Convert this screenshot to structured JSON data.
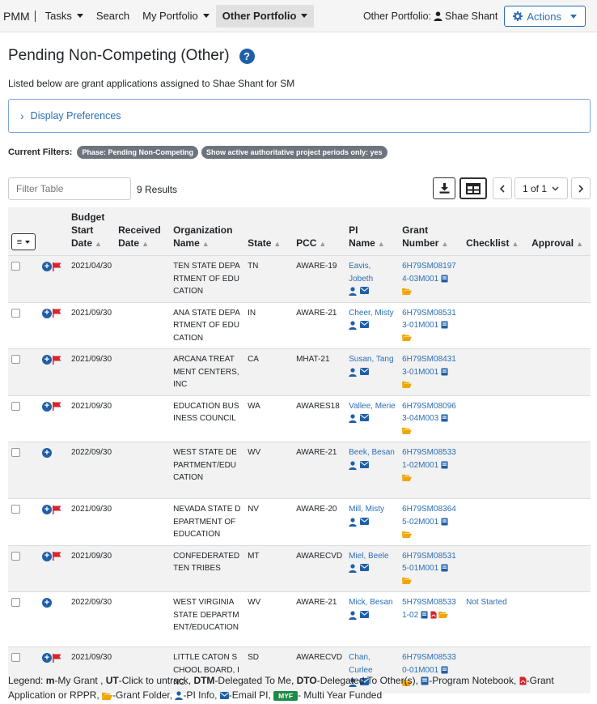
{
  "nav": {
    "brand": "PMM",
    "items": [
      {
        "label": "Tasks",
        "dropdown": true
      },
      {
        "label": "Search",
        "dropdown": false
      },
      {
        "label": "My Portfolio",
        "dropdown": true
      },
      {
        "label": "Other Portfolio",
        "dropdown": true,
        "active": true
      }
    ],
    "other_portfolio_label": "Other Portfolio:",
    "other_portfolio_user": "Shae Shant",
    "actions_label": "Actions"
  },
  "page": {
    "title": "Pending Non-Competing (Other)",
    "subtitle": "Listed below are grant applications assigned to Shae Shant for SM",
    "display_preferences": "Display Preferences",
    "current_filters_label": "Current Filters:",
    "filters": [
      "Phase: Pending Non-Competing",
      "Show active authoritative project periods only: yes"
    ]
  },
  "toolbar": {
    "filter_placeholder": "Filter Table",
    "results": "9 Results",
    "page": "1 of 1"
  },
  "table": {
    "headers": [
      "Budget Start Date",
      "Received Date",
      "Organization Name",
      "State",
      "PCC",
      "PI Name",
      "Grant Number",
      "Checklist",
      "Approval"
    ],
    "rows": [
      {
        "flag": true,
        "budget_start": "2021/04/30",
        "received": "",
        "org": "TEN STATE DEPARTMENT OF EDUCATION",
        "state": "TN",
        "pcc": "AWARE-19",
        "pi": "Eavis, Jobeth",
        "grant": "6H79SM081974-03M001",
        "pdf": false,
        "checklist": "",
        "approval": ""
      },
      {
        "flag": true,
        "budget_start": "2021/09/30",
        "received": "",
        "org": "ANA STATE DEPARTMENT OF EDUCATION",
        "state": "IN",
        "pcc": "AWARE-21",
        "pi": "Cheer, Misty",
        "grant": "6H79SM085313-01M001",
        "pdf": false,
        "checklist": "",
        "approval": ""
      },
      {
        "flag": true,
        "budget_start": "2021/09/30",
        "received": "",
        "org": "ARCANA TREATMENT CENTERS, INC",
        "state": "CA",
        "pcc": "MHAT-21",
        "pi": "Susan, Tang",
        "grant": "6H79SM084313-01M001",
        "pdf": false,
        "checklist": "",
        "approval": ""
      },
      {
        "flag": true,
        "budget_start": "2021/09/30",
        "received": "",
        "org": "EDUCATION BUSINESS COUNCIL",
        "state": "WA",
        "pcc": "AWARES18",
        "pi": "Vallee, Merie",
        "grant": "6H79SM080963-04M003",
        "pdf": false,
        "checklist": "",
        "approval": ""
      },
      {
        "flag": false,
        "budget_start": "2022/09/30",
        "received": "",
        "org": "WEST STATE DEPARTMENT/EDUCATION",
        "state": "WV",
        "pcc": "AWARE-21",
        "pi": "Beek, Besan",
        "grant": "6H79SM085331-02M001",
        "pdf": false,
        "checklist": "",
        "approval": ""
      },
      {
        "flag": true,
        "budget_start": "2021/09/30",
        "received": "",
        "org": "NEVADA STATE DEPARTMENT OF EDUCATION",
        "state": "NV",
        "pcc": "AWARE-20",
        "pi": "Mill, Misty",
        "grant": "6H79SM083645-02M001",
        "pdf": false,
        "checklist": "",
        "approval": ""
      },
      {
        "flag": true,
        "budget_start": "2021/09/30",
        "received": "",
        "org": "CONFEDERATED TEN TRIBES",
        "state": "MT",
        "pcc": "AWARECVD",
        "pi": "Miel, Beele",
        "grant": "6H79SM085315-01M001",
        "pdf": false,
        "checklist": "",
        "approval": ""
      },
      {
        "flag": false,
        "budget_start": "2022/09/30",
        "received": "",
        "org": "WEST VIRGINIA STATE DEPARTMENT/EDUCATION",
        "state": "WV",
        "pcc": "AWARE-21",
        "pi": "Mick, Besan",
        "grant": "5H79SM085331-02",
        "pdf": true,
        "checklist": "Not Started",
        "approval": ""
      },
      {
        "flag": true,
        "budget_start": "2021/09/30",
        "received": "",
        "org": "LITTLE CATON SCHOOL BOARD, INC.",
        "state": "SD",
        "pcc": "AWARECVD",
        "pi": "Chan, Curlee",
        "grant": "6H79SM085330-01M001",
        "pdf": false,
        "checklist": "",
        "approval": ""
      }
    ]
  },
  "legend": {
    "parts": [
      {
        "k": "m",
        "v": "-My Grant , "
      },
      {
        "k": "UT",
        "v": "-Click to untrack, "
      },
      {
        "k": "DTM",
        "v": "-Delegated To Me, "
      },
      {
        "k": "DTO",
        "v": "-Delegated To Other(s), "
      }
    ],
    "notebook": "-Program Notebook, ",
    "application": "-Grant Application or RPPR, ",
    "folder": "-Grant Folder, ",
    "pi_info": "-PI Info, ",
    "email": "-Email PI, ",
    "myf_badge": "MYF",
    "myf": "- Multi Year Funded"
  },
  "colors": {
    "link": "#2a6fb6",
    "primary_icon": "#1f5fa8",
    "flag": "#d9232e",
    "folder": "#f0a500",
    "pdf": "#d9232e",
    "myf": "#1e8a44"
  }
}
